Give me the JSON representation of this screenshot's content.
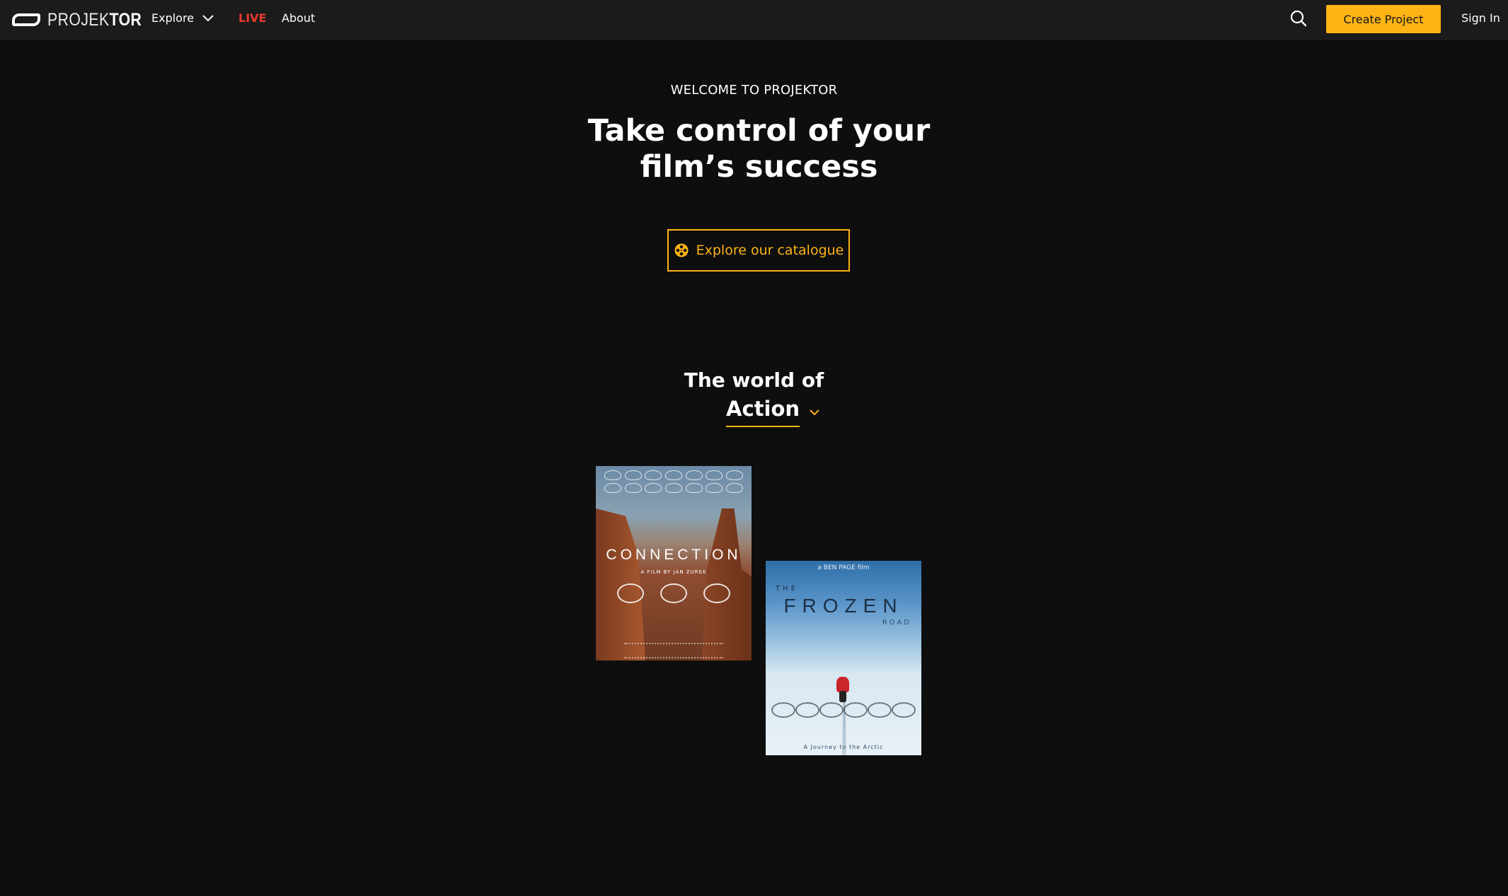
{
  "nav": {
    "logo_light": "PROJEK",
    "logo_bold": "TOR",
    "explore": "Explore",
    "live": "LIVE",
    "about": "About",
    "create_project": "Create Project",
    "sign_in": "Sign In"
  },
  "hero": {
    "welcome": "WELCOME TO PROJEKTOR",
    "headline": "Take control of your film’s success",
    "cta": "Explore our catalogue"
  },
  "world": {
    "title": "The world of",
    "genre": "Action"
  },
  "posters": [
    {
      "title": "CONNECTION",
      "subtitle": "A FILM BY JAN ZUREK"
    },
    {
      "byline": "a BEN PAGE film",
      "the": "THE",
      "title": "FROZEN",
      "road": "ROAD",
      "tagline": "A Journey to the Arctic"
    }
  ],
  "colors": {
    "accent": "#fdb415",
    "live": "#ea3b2e",
    "navbar": "#1b1b1b",
    "background": "#0e0e0e"
  },
  "icons": [
    "projektor-logo",
    "chevron-down-icon",
    "search-icon",
    "film-reel-icon"
  ]
}
